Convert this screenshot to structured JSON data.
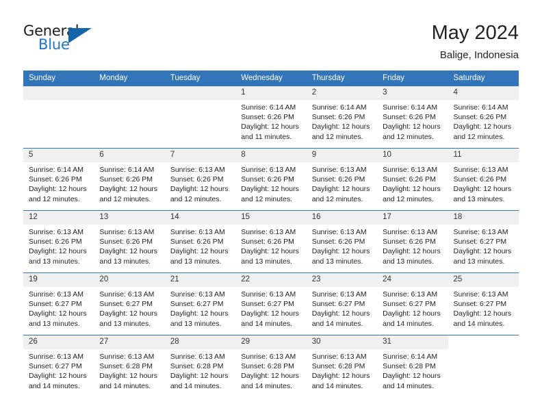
{
  "logo": {
    "word1": "General",
    "word2": "Blue",
    "triangle_color": "#1565a8",
    "blue_text_color": "#1c76c4",
    "icon": "triangle-logo-icon"
  },
  "header": {
    "month_title": "May 2024",
    "location": "Balige, Indonesia"
  },
  "theme": {
    "header_bg": "#3275b9",
    "daynum_bg": "#f0f0f0",
    "row_divider": "#3275b9",
    "text": "#222222"
  },
  "weekdays": [
    "Sunday",
    "Monday",
    "Tuesday",
    "Wednesday",
    "Thursday",
    "Friday",
    "Saturday"
  ],
  "labels": {
    "sunrise_prefix": "Sunrise:",
    "sunset_prefix": "Sunset:",
    "daylight_prefix": "Daylight:"
  },
  "weeks": [
    [
      {
        "day": "",
        "blank": true,
        "sunrise": "",
        "sunset": "",
        "daylight_line1": "",
        "daylight_line2": ""
      },
      {
        "day": "",
        "blank": true,
        "sunrise": "",
        "sunset": "",
        "daylight_line1": "",
        "daylight_line2": ""
      },
      {
        "day": "",
        "blank": true,
        "sunrise": "",
        "sunset": "",
        "daylight_line1": "",
        "daylight_line2": ""
      },
      {
        "day": "1",
        "sunrise": "Sunrise: 6:14 AM",
        "sunset": "Sunset: 6:26 PM",
        "daylight_line1": "Daylight: 12 hours",
        "daylight_line2": "and 11 minutes."
      },
      {
        "day": "2",
        "sunrise": "Sunrise: 6:14 AM",
        "sunset": "Sunset: 6:26 PM",
        "daylight_line1": "Daylight: 12 hours",
        "daylight_line2": "and 12 minutes."
      },
      {
        "day": "3",
        "sunrise": "Sunrise: 6:14 AM",
        "sunset": "Sunset: 6:26 PM",
        "daylight_line1": "Daylight: 12 hours",
        "daylight_line2": "and 12 minutes."
      },
      {
        "day": "4",
        "sunrise": "Sunrise: 6:14 AM",
        "sunset": "Sunset: 6:26 PM",
        "daylight_line1": "Daylight: 12 hours",
        "daylight_line2": "and 12 minutes."
      }
    ],
    [
      {
        "day": "5",
        "sunrise": "Sunrise: 6:14 AM",
        "sunset": "Sunset: 6:26 PM",
        "daylight_line1": "Daylight: 12 hours",
        "daylight_line2": "and 12 minutes."
      },
      {
        "day": "6",
        "sunrise": "Sunrise: 6:14 AM",
        "sunset": "Sunset: 6:26 PM",
        "daylight_line1": "Daylight: 12 hours",
        "daylight_line2": "and 12 minutes."
      },
      {
        "day": "7",
        "sunrise": "Sunrise: 6:13 AM",
        "sunset": "Sunset: 6:26 PM",
        "daylight_line1": "Daylight: 12 hours",
        "daylight_line2": "and 12 minutes."
      },
      {
        "day": "8",
        "sunrise": "Sunrise: 6:13 AM",
        "sunset": "Sunset: 6:26 PM",
        "daylight_line1": "Daylight: 12 hours",
        "daylight_line2": "and 12 minutes."
      },
      {
        "day": "9",
        "sunrise": "Sunrise: 6:13 AM",
        "sunset": "Sunset: 6:26 PM",
        "daylight_line1": "Daylight: 12 hours",
        "daylight_line2": "and 12 minutes."
      },
      {
        "day": "10",
        "sunrise": "Sunrise: 6:13 AM",
        "sunset": "Sunset: 6:26 PM",
        "daylight_line1": "Daylight: 12 hours",
        "daylight_line2": "and 12 minutes."
      },
      {
        "day": "11",
        "sunrise": "Sunrise: 6:13 AM",
        "sunset": "Sunset: 6:26 PM",
        "daylight_line1": "Daylight: 12 hours",
        "daylight_line2": "and 13 minutes."
      }
    ],
    [
      {
        "day": "12",
        "sunrise": "Sunrise: 6:13 AM",
        "sunset": "Sunset: 6:26 PM",
        "daylight_line1": "Daylight: 12 hours",
        "daylight_line2": "and 13 minutes."
      },
      {
        "day": "13",
        "sunrise": "Sunrise: 6:13 AM",
        "sunset": "Sunset: 6:26 PM",
        "daylight_line1": "Daylight: 12 hours",
        "daylight_line2": "and 13 minutes."
      },
      {
        "day": "14",
        "sunrise": "Sunrise: 6:13 AM",
        "sunset": "Sunset: 6:26 PM",
        "daylight_line1": "Daylight: 12 hours",
        "daylight_line2": "and 13 minutes."
      },
      {
        "day": "15",
        "sunrise": "Sunrise: 6:13 AM",
        "sunset": "Sunset: 6:26 PM",
        "daylight_line1": "Daylight: 12 hours",
        "daylight_line2": "and 13 minutes."
      },
      {
        "day": "16",
        "sunrise": "Sunrise: 6:13 AM",
        "sunset": "Sunset: 6:26 PM",
        "daylight_line1": "Daylight: 12 hours",
        "daylight_line2": "and 13 minutes."
      },
      {
        "day": "17",
        "sunrise": "Sunrise: 6:13 AM",
        "sunset": "Sunset: 6:26 PM",
        "daylight_line1": "Daylight: 12 hours",
        "daylight_line2": "and 13 minutes."
      },
      {
        "day": "18",
        "sunrise": "Sunrise: 6:13 AM",
        "sunset": "Sunset: 6:27 PM",
        "daylight_line1": "Daylight: 12 hours",
        "daylight_line2": "and 13 minutes."
      }
    ],
    [
      {
        "day": "19",
        "sunrise": "Sunrise: 6:13 AM",
        "sunset": "Sunset: 6:27 PM",
        "daylight_line1": "Daylight: 12 hours",
        "daylight_line2": "and 13 minutes."
      },
      {
        "day": "20",
        "sunrise": "Sunrise: 6:13 AM",
        "sunset": "Sunset: 6:27 PM",
        "daylight_line1": "Daylight: 12 hours",
        "daylight_line2": "and 13 minutes."
      },
      {
        "day": "21",
        "sunrise": "Sunrise: 6:13 AM",
        "sunset": "Sunset: 6:27 PM",
        "daylight_line1": "Daylight: 12 hours",
        "daylight_line2": "and 13 minutes."
      },
      {
        "day": "22",
        "sunrise": "Sunrise: 6:13 AM",
        "sunset": "Sunset: 6:27 PM",
        "daylight_line1": "Daylight: 12 hours",
        "daylight_line2": "and 14 minutes."
      },
      {
        "day": "23",
        "sunrise": "Sunrise: 6:13 AM",
        "sunset": "Sunset: 6:27 PM",
        "daylight_line1": "Daylight: 12 hours",
        "daylight_line2": "and 14 minutes."
      },
      {
        "day": "24",
        "sunrise": "Sunrise: 6:13 AM",
        "sunset": "Sunset: 6:27 PM",
        "daylight_line1": "Daylight: 12 hours",
        "daylight_line2": "and 14 minutes."
      },
      {
        "day": "25",
        "sunrise": "Sunrise: 6:13 AM",
        "sunset": "Sunset: 6:27 PM",
        "daylight_line1": "Daylight: 12 hours",
        "daylight_line2": "and 14 minutes."
      }
    ],
    [
      {
        "day": "26",
        "sunrise": "Sunrise: 6:13 AM",
        "sunset": "Sunset: 6:27 PM",
        "daylight_line1": "Daylight: 12 hours",
        "daylight_line2": "and 14 minutes."
      },
      {
        "day": "27",
        "sunrise": "Sunrise: 6:13 AM",
        "sunset": "Sunset: 6:28 PM",
        "daylight_line1": "Daylight: 12 hours",
        "daylight_line2": "and 14 minutes."
      },
      {
        "day": "28",
        "sunrise": "Sunrise: 6:13 AM",
        "sunset": "Sunset: 6:28 PM",
        "daylight_line1": "Daylight: 12 hours",
        "daylight_line2": "and 14 minutes."
      },
      {
        "day": "29",
        "sunrise": "Sunrise: 6:13 AM",
        "sunset": "Sunset: 6:28 PM",
        "daylight_line1": "Daylight: 12 hours",
        "daylight_line2": "and 14 minutes."
      },
      {
        "day": "30",
        "sunrise": "Sunrise: 6:13 AM",
        "sunset": "Sunset: 6:28 PM",
        "daylight_line1": "Daylight: 12 hours",
        "daylight_line2": "and 14 minutes."
      },
      {
        "day": "31",
        "sunrise": "Sunrise: 6:14 AM",
        "sunset": "Sunset: 6:28 PM",
        "daylight_line1": "Daylight: 12 hours",
        "daylight_line2": "and 14 minutes."
      },
      {
        "day": "",
        "blank": true,
        "sunrise": "",
        "sunset": "",
        "daylight_line1": "",
        "daylight_line2": ""
      }
    ]
  ]
}
